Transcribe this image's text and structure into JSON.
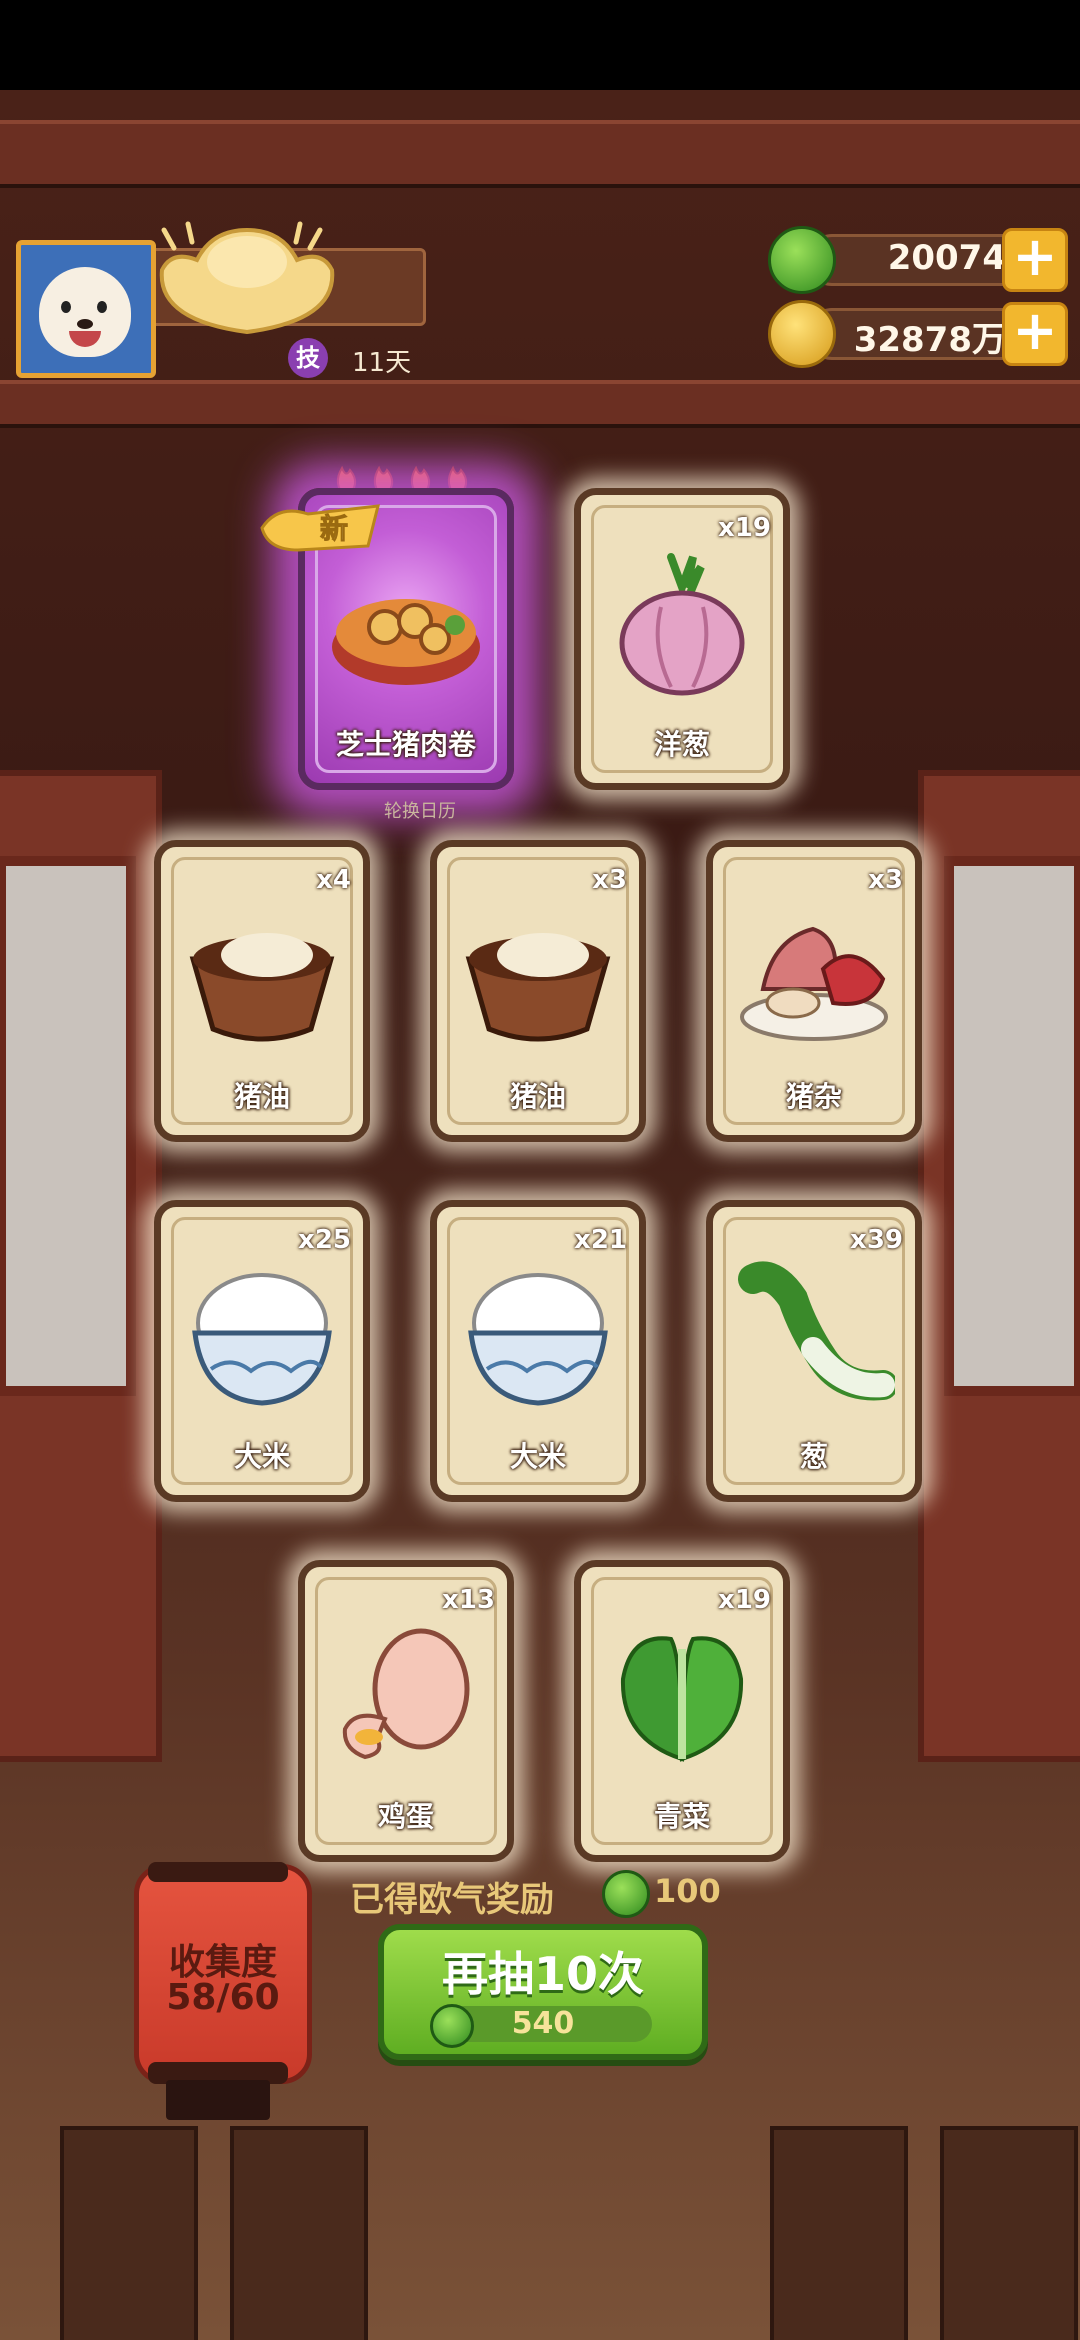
{
  "header": {
    "days_label": "11天",
    "skill_badge": "技"
  },
  "currency": {
    "jade": "20074",
    "gold": "32878万",
    "plus_symbol": "+"
  },
  "featured": {
    "new_tag": "新",
    "stars": 4
  },
  "rotate_label": "轮换日历",
  "cards": [
    {
      "label": "芝士猪肉卷",
      "count": "",
      "special": true
    },
    {
      "label": "洋葱",
      "count": "x19",
      "special": false
    },
    {
      "label": "猪油",
      "count": "x4",
      "special": false
    },
    {
      "label": "猪油",
      "count": "x3",
      "special": false
    },
    {
      "label": "猪杂",
      "count": "x3",
      "special": false
    },
    {
      "label": "大米",
      "count": "x25",
      "special": false
    },
    {
      "label": "大米",
      "count": "x21",
      "special": false
    },
    {
      "label": "葱",
      "count": "x39",
      "special": false
    },
    {
      "label": "鸡蛋",
      "count": "x13",
      "special": false
    },
    {
      "label": "青菜",
      "count": "x19",
      "special": false
    }
  ],
  "reward": {
    "text": "已得欧气奖励",
    "value": "100"
  },
  "draw_button": {
    "title": "再抽10次",
    "cost": "540"
  },
  "collection": {
    "title": "收集度",
    "progress": "58/60"
  },
  "colors": {
    "jade_green": "#3fa52a",
    "gold_coin": "#f2b72e",
    "special_glow": "#c35ed6"
  }
}
